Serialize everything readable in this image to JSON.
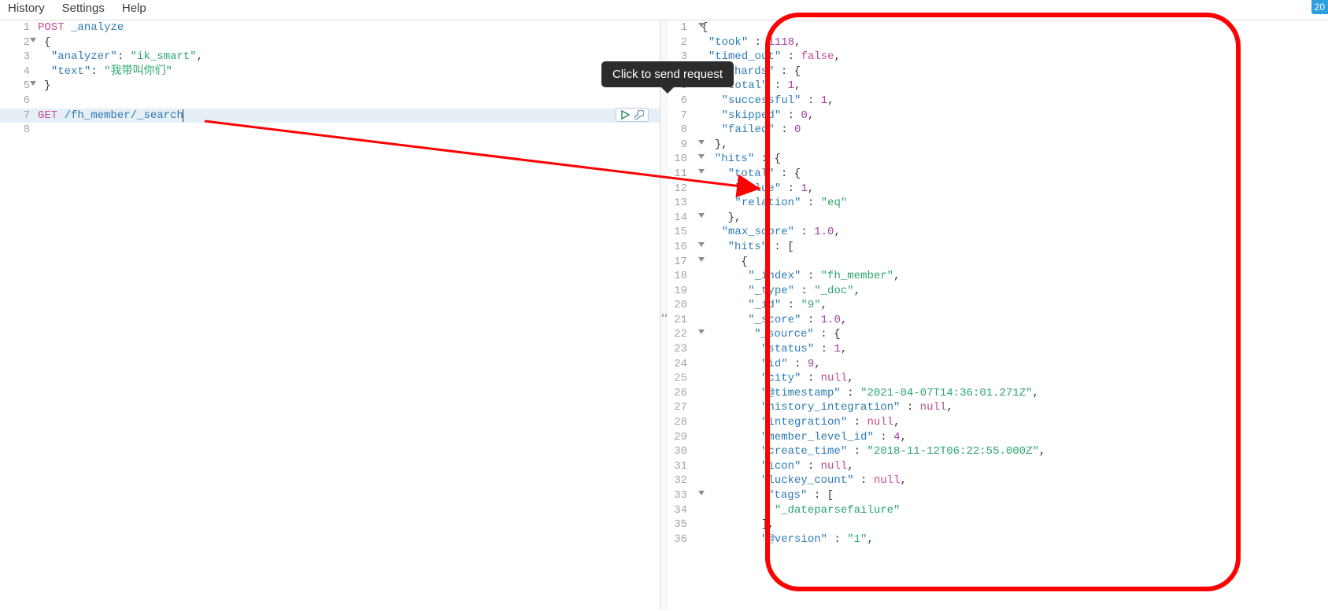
{
  "menubar": {
    "history": "History",
    "settings": "Settings",
    "help": "Help"
  },
  "tooltip": "Click to send request",
  "badge": "20",
  "request": {
    "method_post": "POST",
    "endpoint_post": "_analyze",
    "brace_open": "{",
    "key_analyzer": "\"analyzer\"",
    "val_analyzer": "\"ik_smart\"",
    "key_text": "\"text\"",
    "val_text": "\"我带叫你们\"",
    "brace_close": "}",
    "method_get": "GET",
    "endpoint_get": "/fh_member/_search"
  },
  "response": {
    "open": "{",
    "took_k": "\"took\"",
    "took_v": "1118",
    "timed_k": "\"timed_out\"",
    "timed_v": "false",
    "shards_k": "\"_shards\"",
    "l_open": "{",
    "total_k": "\"total\"",
    "total_v": "1",
    "succ_k": "\"successful\"",
    "succ_v": "1",
    "skip_k": "\"skipped\"",
    "skip_v": "0",
    "fail_k": "\"failed\"",
    "fail_v": "0",
    "close_b": "},",
    "hits_k": "\"hits\"",
    "htot_k": "\"total\"",
    "value_k": "\"value\"",
    "value_v": "1",
    "rel_k": "\"relation\"",
    "rel_v": "\"eq\"",
    "maxs_k": "\"max_score\"",
    "maxs_v": "1.0",
    "hitsarr_k": "\"hits\"",
    "arr_open": "[",
    "idx_k": "\"_index\"",
    "idx_v": "\"fh_member\"",
    "type_k": "\"_type\"",
    "type_v": "\"_doc\"",
    "id_k": "\"_id\"",
    "id_v": "\"9\"",
    "score_k": "\"_score\"",
    "score_v": "1.0",
    "src_k": "\"_source\"",
    "status_k": "\"status\"",
    "status_v": "1",
    "sid_k": "\"id\"",
    "sid_v": "9",
    "city_k": "\"city\"",
    "null": "null",
    "ts_k": "\"@timestamp\"",
    "ts_v": "\"2021-04-07T14:36:01.271Z\"",
    "hist_k": "\"history_integration\"",
    "integ_k": "\"integration\"",
    "mlvl_k": "\"member_level_id\"",
    "mlvl_v": "4",
    "ctime_k": "\"create_time\"",
    "ctime_v": "\"2018-11-12T06:22:55.000Z\"",
    "icon_k": "\"icon\"",
    "luck_k": "\"luckey_count\"",
    "tags_k": "\"tags\"",
    "dpf": "\"_dateparsefailure\"",
    "arr_close": "],",
    "ver_k": "\"@version\"",
    "ver_v": "\"1\""
  }
}
